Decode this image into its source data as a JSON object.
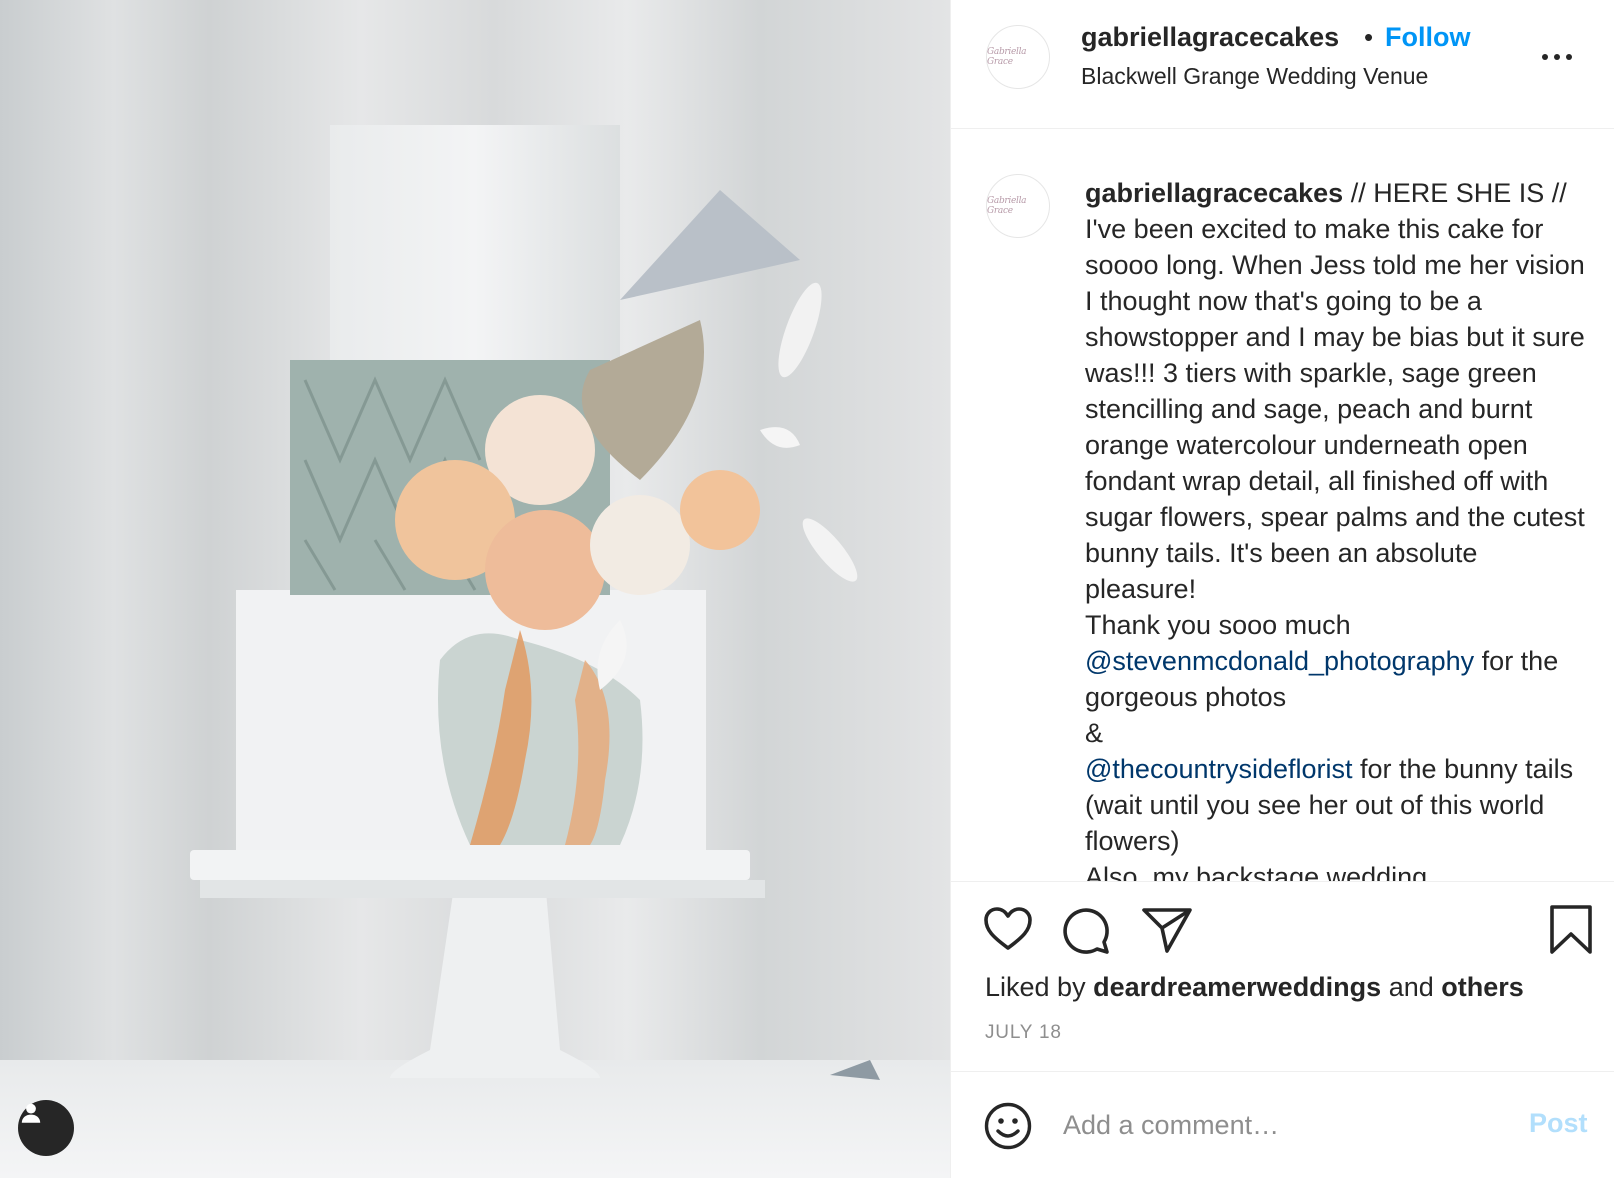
{
  "post": {
    "image_alt": "Three-tier wedding cake with sparkle top tier, sage green stencilled middle tier, watercolour bottom tier, sugar flowers, spear palms and bunny tails on a white cake stand"
  },
  "header": {
    "avatar_text": "Gabriella Grace",
    "username": "gabriellagracecakes",
    "separator": "•",
    "follow_label": "Follow",
    "location": "Blackwell Grange Wedding Venue"
  },
  "caption": {
    "username": "gabriellagracecakes",
    "text_1": " // HERE SHE IS // I've been excited to make this cake for soooo long. When Jess told me her vision I thought now that's going to be a showstopper and I may be bias but it sure was!!! 3 tiers with sparkle, sage green stencilling and sage, peach and burnt orange watercolour underneath open fondant wrap detail, all finished off with sugar flowers, spear palms and the cutest bunny tails. It's been an absolute pleasure!",
    "text_2": "Thank you sooo much ",
    "mention_1": "@stevenmcdonald_photography",
    "text_3": " for the gorgeous photos",
    "text_4": "&",
    "mention_2": "@thecountrysideflorist",
    "text_5": " for the bunny tails (wait until you see her out of this world flowers)",
    "text_6": "Also, my backstage wedding"
  },
  "actions": {
    "liked_by_prefix": "Liked by ",
    "liked_by_user": "deardreamerweddings",
    "liked_by_and": " and ",
    "liked_by_others": "others",
    "date": "JULY 18"
  },
  "comment": {
    "placeholder": "Add a comment…",
    "post_label": "Post"
  },
  "colors": {
    "accent": "#0095f6",
    "mention": "#00376b",
    "post_disabled": "#b2dffc"
  }
}
